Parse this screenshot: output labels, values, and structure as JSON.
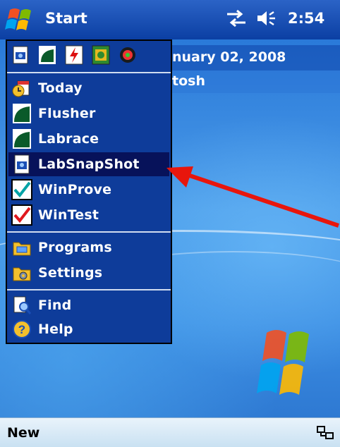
{
  "titlebar": {
    "title": "Start",
    "clock": "2:54",
    "icons": [
      "start-flag-icon",
      "connectivity-arrows-icon",
      "speaker-volume-icon"
    ]
  },
  "today": {
    "date": "nuary 02, 2008",
    "owner": "tosh"
  },
  "start_menu": {
    "recent_icons": [
      "labsnapshot-icon",
      "flusher-icon",
      "flash-app-icon",
      "green-square-app-icon",
      "disc-app-icon"
    ],
    "items": [
      {
        "label": "Today",
        "icon": "today-icon"
      },
      {
        "label": "Flusher",
        "icon": "flusher-icon"
      },
      {
        "label": "Labrace",
        "icon": "labrace-icon"
      },
      {
        "label": "LabSnapShot",
        "icon": "labsnapshot-icon",
        "selected": true
      },
      {
        "label": "WinProve",
        "icon": "checkmark-icon"
      },
      {
        "label": "WinTest",
        "icon": "red-checkmark-icon"
      },
      {
        "label": "Programs",
        "icon": "programs-folder-icon"
      },
      {
        "label": "Settings",
        "icon": "settings-folder-icon"
      },
      {
        "label": "Find",
        "icon": "find-icon"
      },
      {
        "label": "Help",
        "icon": "help-icon"
      }
    ]
  },
  "bottombar": {
    "softkey_left": "New",
    "icon": "connection-icon"
  },
  "colors": {
    "titlebar": "#0b3fa3",
    "menu_bg": "#0e3c9a",
    "selected_bg": "#07125a",
    "arrow": "#e8160c"
  }
}
